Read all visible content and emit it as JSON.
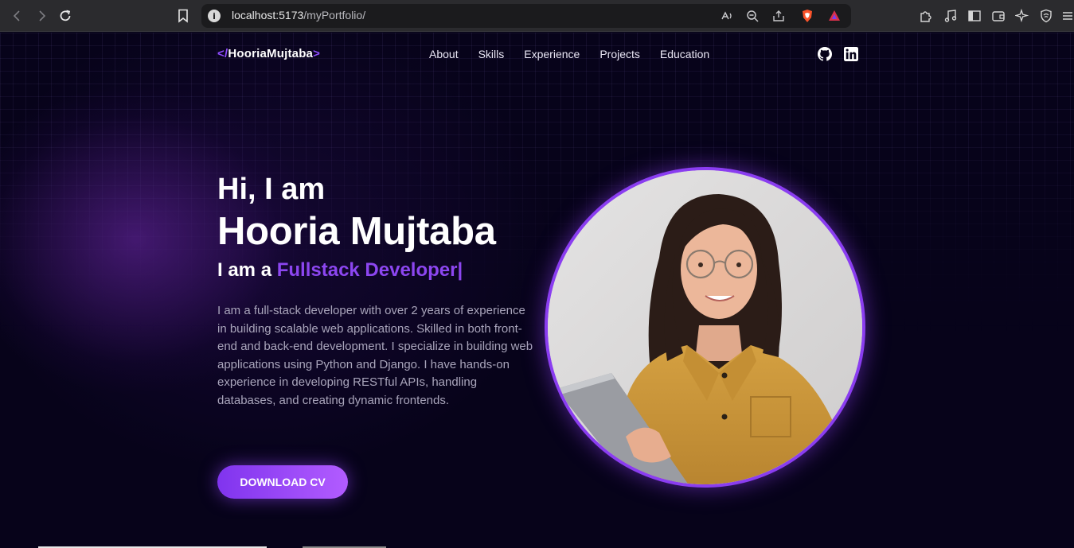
{
  "browser": {
    "url_host": "localhost:5173",
    "url_path": "/myPortfolio/",
    "icons": [
      "back-icon",
      "forward-icon",
      "reload-icon",
      "bookmark-icon",
      "site-info-icon",
      "read-aloud-icon",
      "zoom-out-icon",
      "share-icon",
      "brave-shields-icon",
      "brave-rewards-icon",
      "extensions-icon",
      "media-icon",
      "sidebar-icon",
      "wallet-icon",
      "leo-ai-icon",
      "vpn-icon",
      "menu-icon"
    ]
  },
  "site": {
    "logo_open": "</",
    "logo_name": "HooriaMujtaba",
    "logo_close": ">",
    "nav": [
      {
        "label": "About"
      },
      {
        "label": "Skills"
      },
      {
        "label": "Experience"
      },
      {
        "label": "Projects"
      },
      {
        "label": "Education"
      }
    ],
    "social_icons": [
      "github-icon",
      "linkedin-icon"
    ]
  },
  "hero": {
    "greeting": "Hi, I am",
    "name": "Hooria Mujtaba",
    "role_prefix": "I am a ",
    "role_highlight": "Fullstack Developer|",
    "bio": "I am a full-stack developer with over 2 years of experience in building scalable web applications. Skilled in both front-end and back-end development. I specialize in building web applications using Python and Django. I have hands-on experience in developing RESTful APIs, handling databases, and creating dynamic frontends.",
    "cta_label": "DOWNLOAD CV"
  },
  "colors": {
    "accent": "#8c46f0",
    "background": "#07031a",
    "button_gradient_start": "#8034ee",
    "button_gradient_end": "#b25cff"
  }
}
